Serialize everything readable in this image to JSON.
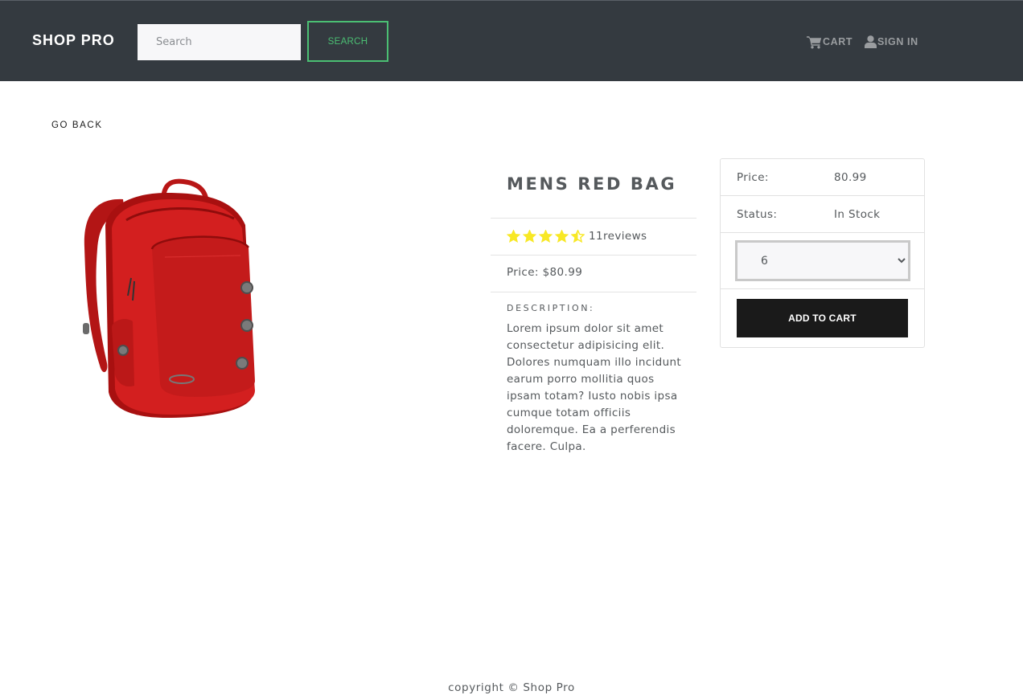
{
  "brand": "SHOP PRO",
  "search": {
    "placeholder": "Search",
    "button_label": "SEARCH"
  },
  "nav": {
    "cart_label": "CART",
    "cart_icon": "shopping-cart-icon",
    "signin_label": "SIGN IN",
    "signin_icon": "user-icon"
  },
  "go_back": "GO BACK",
  "product": {
    "title": "MENS RED BAG",
    "image_alt": "red backpack",
    "rating": 4.5,
    "rating_max": 5,
    "reviews_text": "11reviews",
    "price_line": "Price: $80.99",
    "description_heading": "DESCRIPTION:",
    "description": "Lorem ipsum dolor sit amet consectetur adipisicing elit. Dolores numquam illo incidunt earum porro mollitia quos ipsam totam? Iusto nobis ipsa cumque totam officiis doloremque. Ea a perferendis facere. Culpa."
  },
  "purchase": {
    "price_label": "Price:",
    "price_value": "80.99",
    "status_label": "Status:",
    "status_value": "In Stock",
    "qty_selected": "6",
    "add_button": "ADD TO CART"
  },
  "colors": {
    "navbar": "#343a40",
    "accent_green": "#4bbf73",
    "star": "#f8e825",
    "button_dark": "#1a1a1a",
    "bag_red": "#d31f1f"
  },
  "footer": "copyright © Shop Pro"
}
